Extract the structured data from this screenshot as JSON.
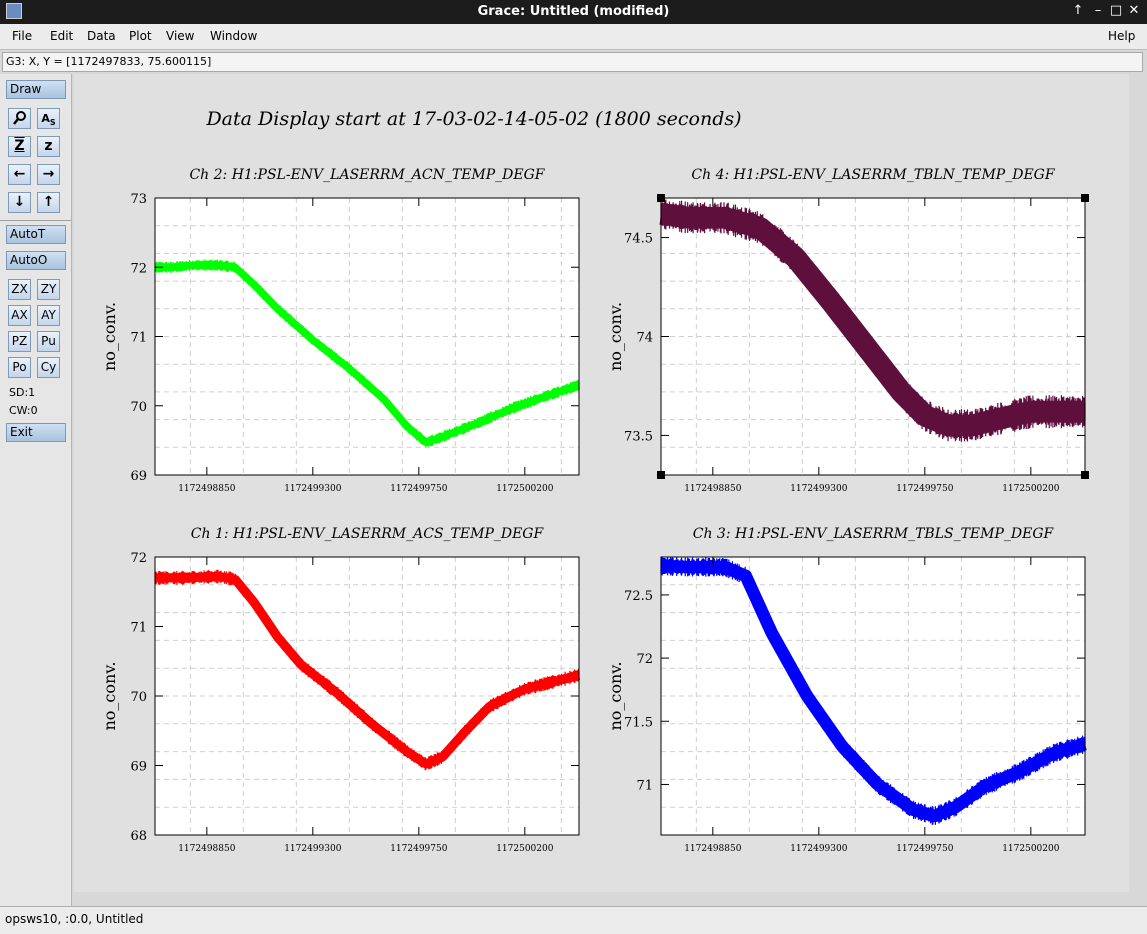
{
  "window": {
    "title": "Grace: Untitled (modified)",
    "controls": [
      "↑",
      "–",
      "□",
      "✕"
    ]
  },
  "menu": [
    "File",
    "Edit",
    "Data",
    "Plot",
    "View",
    "Window",
    "Help"
  ],
  "locator": "G3: X, Y = [1172497833, 75.600115]",
  "toolbar": {
    "draw": "Draw",
    "auto_t": "AutoT",
    "auto_o": "AutoO",
    "zx": "ZX",
    "zy": "ZY",
    "ax": "AX",
    "ay": "AY",
    "pz": "PZ",
    "pu": "Pu",
    "po": "Po",
    "cy": "Cy",
    "sd": "SD:1",
    "cw": "CW:0",
    "exit": "Exit"
  },
  "status": "opsws10, :0.0, Untitled",
  "figure_title": "Data Display start at 17-03-02-14-05-02 (1800 seconds)",
  "chart_data": [
    {
      "type": "line",
      "title": "Ch 2: H1:PSL-ENV_LASERRM_ACN_TEMP_DEGF",
      "ylabel": "no_conv.",
      "xlabel": "",
      "xlim": [
        1172498630,
        1172500430
      ],
      "ylim": [
        69,
        73
      ],
      "xticks": [
        "1172498850",
        "1172499300",
        "1172499750",
        "1172500200"
      ],
      "yticks": [
        "73",
        "72",
        "71",
        "70",
        "69"
      ],
      "color": "#00ff00",
      "grid": true,
      "series": [
        {
          "x": [
            1172498630,
            1172498700,
            1172498800,
            1172498900,
            1172498970,
            1172499050,
            1172499150,
            1172499300,
            1172499450,
            1172499600,
            1172499700,
            1172499780,
            1172499850,
            1172500000,
            1172500150,
            1172500300,
            1172500430
          ],
          "y": [
            72.0,
            72.0,
            72.03,
            72.03,
            72.0,
            71.75,
            71.4,
            70.95,
            70.55,
            70.1,
            69.7,
            69.47,
            69.55,
            69.75,
            69.97,
            70.15,
            70.3
          ],
          "band": 0.1
        }
      ]
    },
    {
      "type": "line",
      "title": "Ch 4: H1:PSL-ENV_LASERRM_TBLN_TEMP_DEGF",
      "ylabel": "no_conv.",
      "xlabel": "",
      "xlim": [
        1172498630,
        1172500430
      ],
      "ylim": [
        73.3,
        74.7
      ],
      "xticks": [
        "1172498850",
        "1172499300",
        "1172499750",
        "1172500200"
      ],
      "yticks": [
        "74.5",
        "74",
        "73.5"
      ],
      "color": "#5e0f3c",
      "grid": true,
      "selected": true,
      "series": [
        {
          "x": [
            1172498630,
            1172498750,
            1172498900,
            1172499050,
            1172499200,
            1172499350,
            1172499500,
            1172499650,
            1172499750,
            1172499850,
            1172499950,
            1172500050,
            1172500200,
            1172500300,
            1172500430
          ],
          "y": [
            74.62,
            74.6,
            74.6,
            74.55,
            74.4,
            74.18,
            73.95,
            73.72,
            73.6,
            73.55,
            73.55,
            73.58,
            73.62,
            73.62,
            73.62
          ],
          "band": 0.1
        }
      ]
    },
    {
      "type": "line",
      "title": "Ch 1: H1:PSL-ENV_LASERRM_ACS_TEMP_DEGF",
      "ylabel": "no_conv.",
      "xlabel": "",
      "xlim": [
        1172498630,
        1172500430
      ],
      "ylim": [
        68,
        72
      ],
      "xticks": [
        "1172498850",
        "1172499300",
        "1172499750",
        "1172500200"
      ],
      "yticks": [
        "72",
        "71",
        "70",
        "69",
        "68"
      ],
      "color": "#ff0000",
      "grid": true,
      "series": [
        {
          "x": [
            1172498630,
            1172498750,
            1172498900,
            1172498970,
            1172499050,
            1172499150,
            1172499250,
            1172499400,
            1172499550,
            1172499700,
            1172499780,
            1172499850,
            1172499950,
            1172500050,
            1172500200,
            1172500430
          ],
          "y": [
            71.7,
            71.7,
            71.72,
            71.68,
            71.35,
            70.85,
            70.45,
            70.05,
            69.6,
            69.2,
            69.02,
            69.12,
            69.5,
            69.85,
            70.1,
            70.3
          ],
          "band": 0.12
        }
      ]
    },
    {
      "type": "line",
      "title": "Ch 3: H1:PSL-ENV_LASERRM_TBLS_TEMP_DEGF",
      "ylabel": "no_conv.",
      "xlabel": "",
      "xlim": [
        1172498630,
        1172500430
      ],
      "ylim": [
        70.6,
        72.8
      ],
      "xticks": [
        "1172498850",
        "1172499300",
        "1172499750",
        "1172500200"
      ],
      "yticks": [
        "72.5",
        "72",
        "71.5",
        "71"
      ],
      "color": "#0000ff",
      "grid": true,
      "series": [
        {
          "x": [
            1172498630,
            1172498750,
            1172498900,
            1172498990,
            1172499100,
            1172499250,
            1172499400,
            1172499550,
            1172499700,
            1172499790,
            1172499880,
            1172500000,
            1172500150,
            1172500300,
            1172500430
          ],
          "y": [
            72.73,
            72.72,
            72.72,
            72.65,
            72.2,
            71.7,
            71.3,
            71.0,
            70.8,
            70.75,
            70.82,
            70.98,
            71.1,
            71.25,
            71.32
          ],
          "band": 0.09
        }
      ]
    }
  ]
}
